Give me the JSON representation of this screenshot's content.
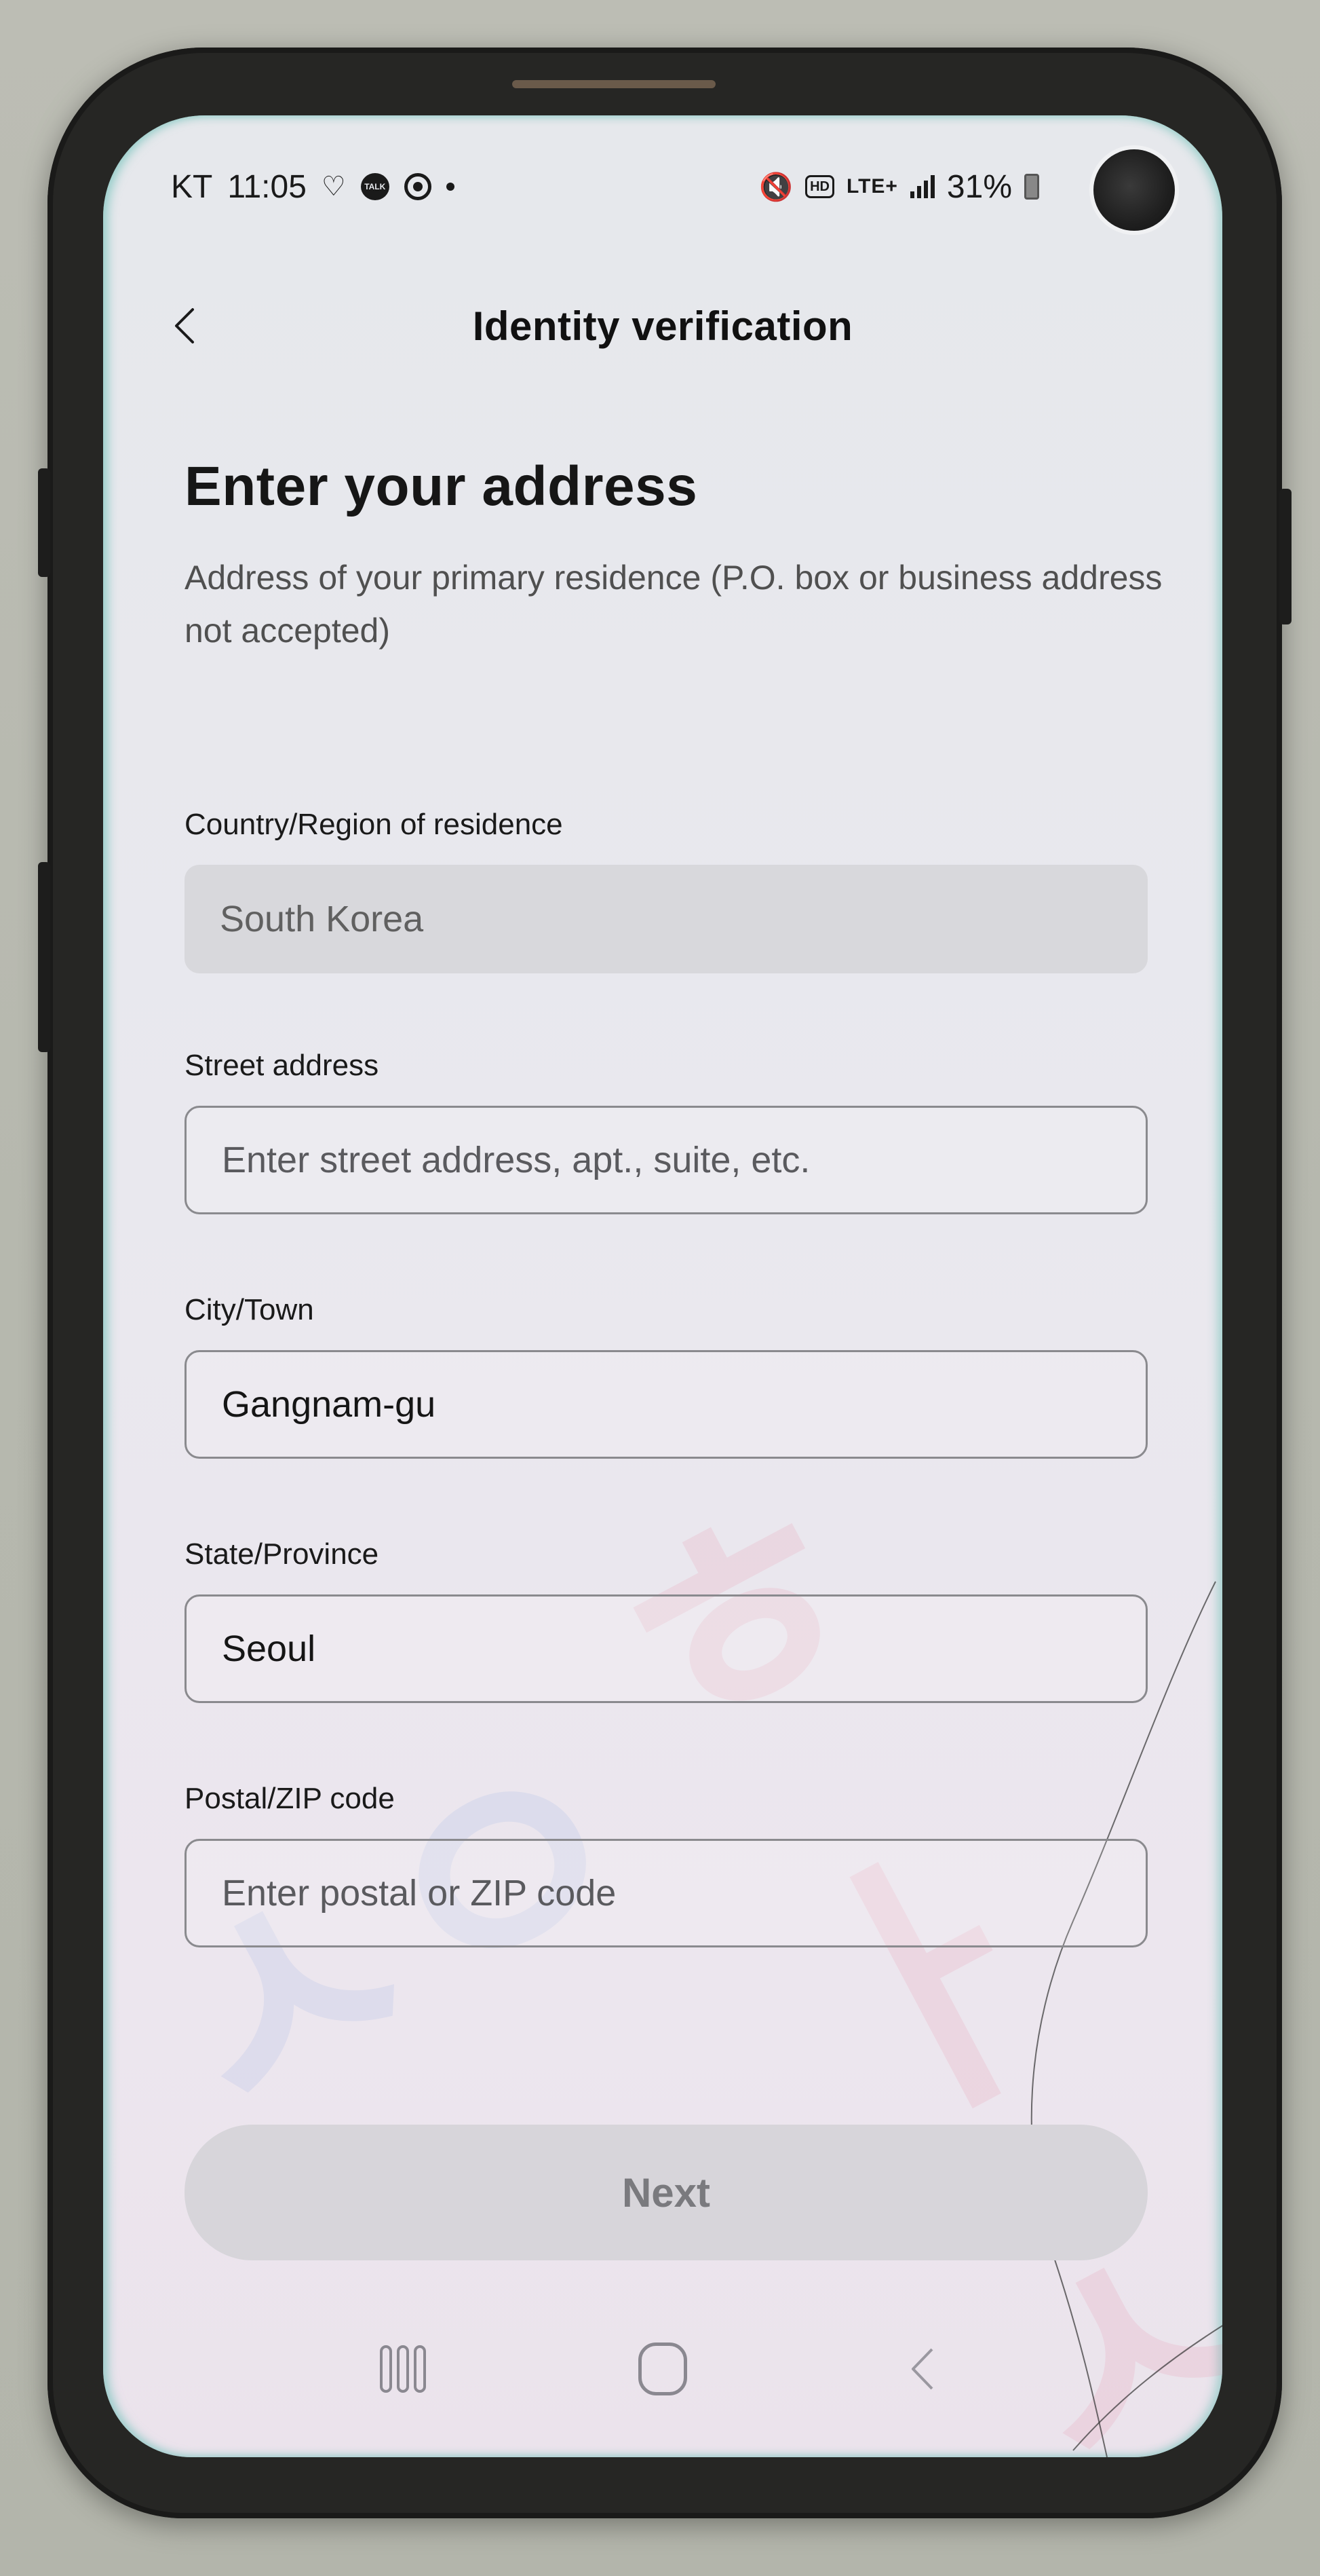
{
  "status_bar": {
    "carrier": "KT",
    "time": "11:05",
    "notification_icons": [
      "voice-assistant-icon",
      "kakaotalk-icon",
      "sync-icon",
      "more-notifications-dot"
    ],
    "talk_badge": "TALK",
    "hd_label": "HD",
    "network_label": "LTE+",
    "battery": "31%"
  },
  "header": {
    "title": "Identity verification",
    "back_label": "Back"
  },
  "page": {
    "title": "Enter your address",
    "subtitle": "Address of your primary residence (P.O. box or business address not accepted)"
  },
  "form": {
    "fields": [
      {
        "label": "Country/Region of residence",
        "value": "South Korea",
        "placeholder": "",
        "disabled": true
      },
      {
        "label": "Street address",
        "value": "",
        "placeholder": "Enter street address, apt., suite, etc.",
        "disabled": false
      },
      {
        "label": "City/Town",
        "value": "Gangnam-gu",
        "placeholder": "",
        "disabled": false
      },
      {
        "label": "State/Province",
        "value": "Seoul",
        "placeholder": "",
        "disabled": false
      },
      {
        "label": "Postal/ZIP code",
        "value": "",
        "placeholder": "Enter postal or ZIP code",
        "disabled": false
      }
    ]
  },
  "actions": {
    "next_label": "Next",
    "next_enabled": false
  },
  "system_nav": {
    "items": [
      "recents",
      "home",
      "back"
    ]
  },
  "colors": {
    "screen_bg": "#e7e8ec",
    "input_border": "#8a8a8e",
    "disabled_input_bg": "#d8d8dc",
    "button_disabled_bg": "#d7d5da",
    "button_disabled_text": "#7a7a7e",
    "title_text": "#161616"
  }
}
